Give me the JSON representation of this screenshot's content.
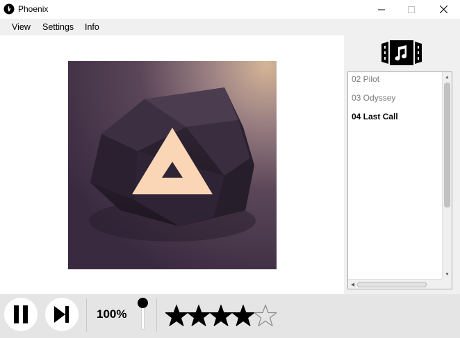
{
  "window": {
    "title": "Phoenix",
    "controls": {
      "minimize": "minimize-icon",
      "maximize": "maximize-icon",
      "close": "close-icon"
    }
  },
  "menu": {
    "items": [
      "View",
      "Settings",
      "Info"
    ]
  },
  "playlist": {
    "icon": "film-music-icon",
    "items": [
      {
        "label": "02 Pilot",
        "current": false
      },
      {
        "label": "03 Odyssey",
        "current": false
      },
      {
        "label": "04 Last Call",
        "current": true
      }
    ]
  },
  "player": {
    "pause_icon": "pause-icon",
    "next_icon": "skip-next-icon",
    "volume_label": "100%",
    "volume_level": 1.0,
    "rating": 4,
    "rating_max": 5
  },
  "colors": {
    "art_bg_dark": "#3e2f47",
    "art_bg_light": "#c8a98e",
    "triangle": "#fbd6b6",
    "control_bar": "#e5e5e5"
  }
}
